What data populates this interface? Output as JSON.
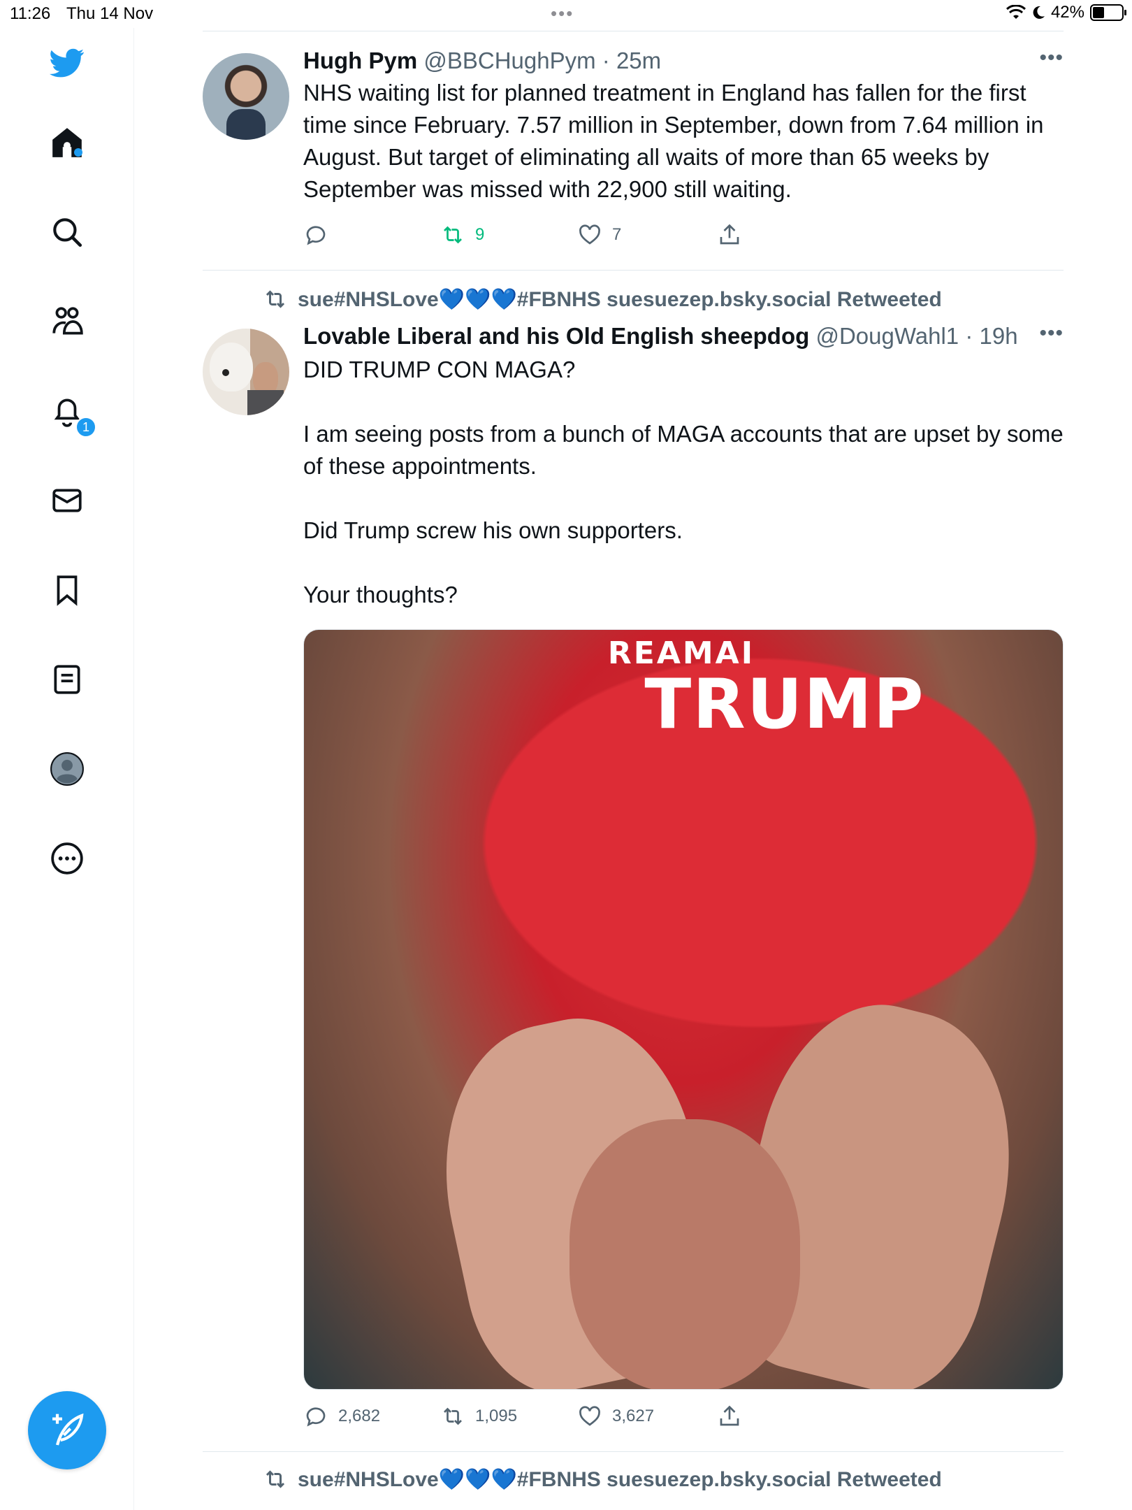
{
  "status_bar": {
    "time": "11:26",
    "date": "Thu 14 Nov",
    "battery": "42%",
    "battery_level": 0.42
  },
  "sidebar": {
    "logo": "twitter-bird-icon",
    "items": [
      {
        "name": "home",
        "icon": "home-icon"
      },
      {
        "name": "explore",
        "icon": "search-icon"
      },
      {
        "name": "communities",
        "icon": "people-icon"
      },
      {
        "name": "notifications",
        "icon": "bell-icon",
        "badge": "1"
      },
      {
        "name": "messages",
        "icon": "mail-icon"
      },
      {
        "name": "bookmarks",
        "icon": "bookmark-icon"
      },
      {
        "name": "lists",
        "icon": "list-icon"
      },
      {
        "name": "profile",
        "icon": "profile-icon"
      },
      {
        "name": "more",
        "icon": "more-icon"
      }
    ],
    "compose_icon": "compose-icon"
  },
  "colors": {
    "accent": "#1d9bf0",
    "retweet_green": "#00ba7c",
    "muted": "#536471"
  },
  "tweets": [
    {
      "name": "Hugh Pym",
      "handle": "@BBCHughPym",
      "time": "25m",
      "text": "NHS waiting list for planned treatment in England has fallen for the first time since February.  7.57 million in September, down from 7.64 million in August. But target of eliminating all waits of more than 65 weeks by September was missed with 22,900 still waiting.",
      "replies": "",
      "retweets": "9",
      "likes": "7"
    },
    {
      "retweeted_by": "sue#NHSLove💙💙💙#FBNHS suesuezep.bsky.social Retweeted",
      "name": "Lovable Liberal and his Old English sheepdog",
      "handle": "@DougWahl1",
      "time": "19h",
      "text": "DID TRUMP CON MAGA?\n\nI am seeing posts from a bunch of MAGA accounts that are upset by some of these appointments.\n\nDid Trump screw his own supporters.\n\nYour thoughts?",
      "media_caption_1": "REAMAI",
      "media_caption_2": "TRUMP",
      "replies": "2,682",
      "retweets": "1,095",
      "likes": "3,627"
    },
    {
      "retweeted_by": "sue#NHSLove💙💙💙#FBNHS suesuezep.bsky.social Retweeted"
    }
  ]
}
